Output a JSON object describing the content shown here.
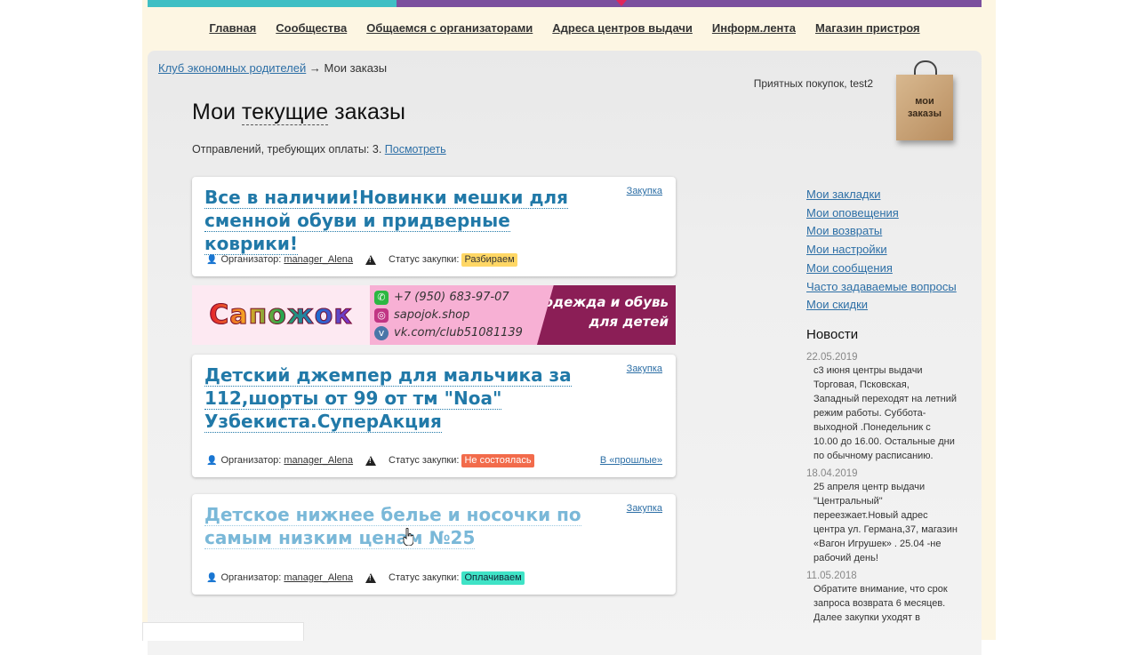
{
  "nav": {
    "items": [
      "Главная",
      "Сообщества",
      "Общаемся с организаторами",
      "Адреса центров выдачи",
      "Информ.лента",
      "Магазин пристроя"
    ]
  },
  "breadcrumb": {
    "root": "Клуб экономных родителей",
    "separator": " → ",
    "current": "Мои заказы"
  },
  "greeting": "Приятных покупок, test2",
  "bag": {
    "line1": "мои",
    "line2": "заказы"
  },
  "page": {
    "title_plain": "Мои ",
    "title_underlined": "текущие",
    "title_rest": " заказы",
    "payment_text": "Отправлений, требующих оплаты: 3.",
    "payment_link": "Посмотреть"
  },
  "labels": {
    "purchase": "Закупка",
    "organizer": "Организатор:",
    "status": "Статус закупки:",
    "past": "В «прошлые»"
  },
  "orders": [
    {
      "title": "Все в наличии!Новинки мешки для сменной обуви и придверные коврики!",
      "organizer": "manager_Alena",
      "status": "Разбираем",
      "status_color": "#ffd765"
    },
    {
      "title": "Детский джемпер для мальчика за 112,шорты от 99 от тм \"Noa\" Узбекиста.СуперАкция",
      "organizer": "manager_Alena",
      "status": "Не состоялась",
      "status_color": "#f26b4b"
    },
    {
      "title": "Детское нижнее белье и носочки по самым низким ценам №25",
      "organizer": "manager_Alena",
      "status": "Оплачиваем",
      "status_color": "#3fe3c6"
    }
  ],
  "banner": {
    "logo": "Сапожок",
    "phone": "+7 (950) 683-97-07",
    "instagram": "sapojok.shop",
    "vk": "vk.com/club51081139",
    "slogan_line1": "одежда и обувь",
    "slogan_line2": "для детей"
  },
  "sidebar": {
    "links": [
      "Мои закладки",
      "Мои оповещения",
      "Мои возвраты",
      "Мои настройки",
      "Мои сообщения",
      "Часто задаваемые вопросы",
      "Мои скидки"
    ],
    "news_title": "Новости",
    "news": [
      {
        "date": "22.05.2019",
        "text": "с3 июня центры выдачи Торговая, Псковская, Западный переходят на летний режим работы. Суббота-выходной .Понедельник с 10.00 до 16.00. Остальные дни по обычному расписанию."
      },
      {
        "date": "18.04.2019",
        "text": "25 апреля центр выдачи \"Центральный\" переезжает.Новый адрес центра ул. Германа,37, магазин «Вагон Игрушек» . 25.04 -не рабочий день!"
      },
      {
        "date": "11.05.2018",
        "text": "Обратите внимание, что срок запроса возврата 6 месяцев. Далее закупки уходят в"
      }
    ]
  }
}
